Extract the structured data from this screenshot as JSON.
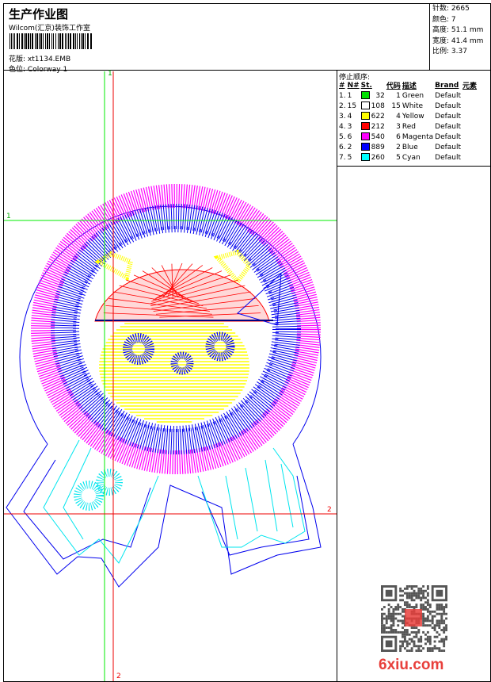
{
  "header": {
    "title": "生产作业图",
    "company": "Wilcom(汇京)装饰工作室",
    "pattern_label": "花版:",
    "pattern_value": "xt1134.EMB",
    "colorway_label": "色位:",
    "colorway_value": "Colorway 1"
  },
  "stats": [
    {
      "label": "针数:",
      "value": "2665"
    },
    {
      "label": "颜色:",
      "value": "7"
    },
    {
      "label": "高度:",
      "value": "51.1 mm"
    },
    {
      "label": "宽度:",
      "value": "41.4 mm"
    },
    {
      "label": "比例:",
      "value": "3.37"
    }
  ],
  "stop_sequence": {
    "title": "停止顺序:",
    "columns": [
      "#",
      "N#",
      "St.",
      "代码",
      "描述",
      "Brand",
      "元素"
    ],
    "rows": [
      {
        "idx": "1.",
        "n": "1",
        "color": "#00e000",
        "st": "32",
        "code": "1",
        "desc": "Green",
        "brand": "Default"
      },
      {
        "idx": "2.",
        "n": "15",
        "color": "#ffffff",
        "st": "108",
        "code": "15",
        "desc": "White",
        "brand": "Default"
      },
      {
        "idx": "3.",
        "n": "4",
        "color": "#ffff00",
        "st": "622",
        "code": "4",
        "desc": "Yellow",
        "brand": "Default"
      },
      {
        "idx": "4.",
        "n": "3",
        "color": "#ff0000",
        "st": "212",
        "code": "3",
        "desc": "Red",
        "brand": "Default"
      },
      {
        "idx": "5.",
        "n": "6",
        "color": "#ff00ff",
        "st": "540",
        "code": "6",
        "desc": "Magenta",
        "brand": "Default"
      },
      {
        "idx": "6.",
        "n": "2",
        "color": "#0000ff",
        "st": "889",
        "code": "2",
        "desc": "Blue",
        "brand": "Default"
      },
      {
        "idx": "7.",
        "n": "5",
        "color": "#00ffff",
        "st": "260",
        "code": "5",
        "desc": "Cyan",
        "brand": "Default"
      }
    ]
  },
  "guides": {
    "green_v": "1",
    "green_h": "1",
    "red_v": "2",
    "red_h": "2"
  },
  "watermark": {
    "logo": "6xiu.com",
    "seal": "以图版"
  }
}
